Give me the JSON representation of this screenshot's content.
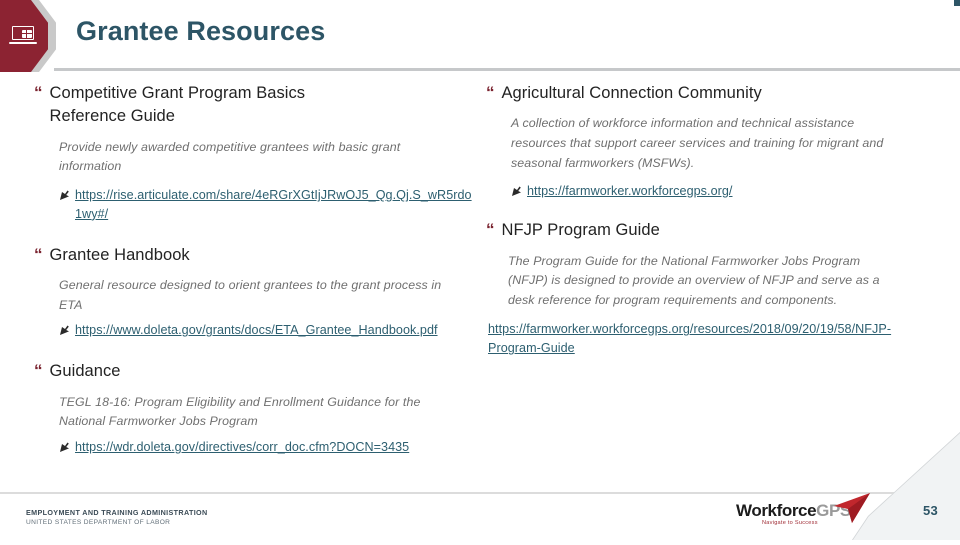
{
  "header": {
    "title": "Grantee Resources",
    "icon": "laptop-globe-icon",
    "accent_color": "#8c2332",
    "title_color": "#2d5566"
  },
  "left_column": [
    {
      "heading": "Competitive Grant Program Basics Reference Guide",
      "description": "Provide newly awarded competitive grantees with basic grant information",
      "link": "https://rise.articulate.com/share/4eRGrXGtIjJRwOJ5_Qg.Qj.S_wR5rdo1wy#/",
      "has_arrow": true
    },
    {
      "heading": "Grantee Handbook",
      "description": "General resource designed to orient grantees to the grant process in ETA",
      "link": "https://www.doleta.gov/grants/docs/ETA_Grantee_Handbook.pdf",
      "has_arrow": true
    },
    {
      "heading": "Guidance",
      "description": "TEGL 18-16: Program Eligibility and Enrollment Guidance for the National Farmworker Jobs Program",
      "link": "https://wdr.doleta.gov/directives/corr_doc.cfm?DOCN=3435",
      "has_arrow": true
    }
  ],
  "right_column": [
    {
      "heading": "Agricultural Connection Community",
      "description": "A collection of workforce information and technical assistance resources that support career services and training for migrant and seasonal farmworkers (MSFWs).",
      "link": "https://farmworker.workforcegps.org/",
      "has_arrow": true
    },
    {
      "heading": "NFJP Program Guide",
      "description": "The Program Guide for the National Farmworker Jobs Program (NFJP) is designed to provide an overview of NFJP and serve as a desk reference for program requirements and components.",
      "link": "https://farmworker.workforcegps.org/resources/2018/09/20/19/58/NFJP-Program-Guide",
      "has_arrow": false
    }
  ],
  "footer": {
    "agency_line1": "EMPLOYMENT AND TRAINING ADMINISTRATION",
    "agency_line2": "UNITED STATES DEPARTMENT OF LABOR",
    "brand_primary": "Workforce",
    "brand_secondary": "GPS",
    "brand_tagline": "Navigate to Success",
    "page_number": "53"
  },
  "glyphs": {
    "bullet": "“",
    "arrow": "arrow-pointer-icon"
  }
}
